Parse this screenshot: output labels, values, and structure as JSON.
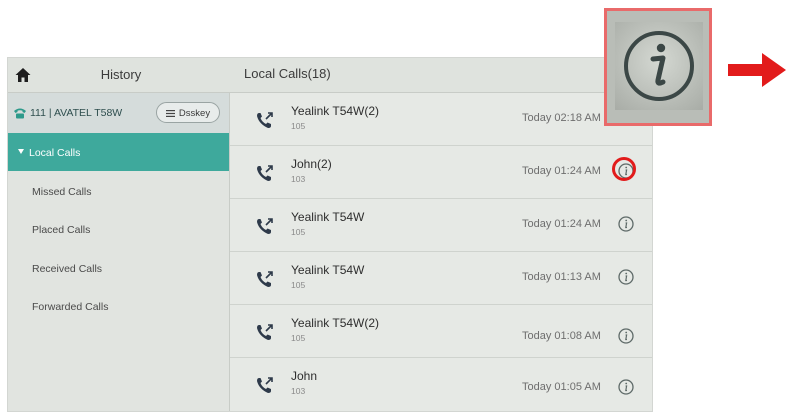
{
  "header": {
    "home_icon": "home-icon",
    "title": "History",
    "content_title": "Local Calls(18)"
  },
  "account": {
    "label": "111 | AVATEL T58W",
    "dsskey_label": "Dsskey"
  },
  "sidebar": {
    "items": [
      {
        "label": "Local Calls",
        "active": true
      },
      {
        "label": "Missed Calls",
        "active": false
      },
      {
        "label": "Placed Calls",
        "active": false
      },
      {
        "label": "Received Calls",
        "active": false
      },
      {
        "label": "Forwarded Calls",
        "active": false
      }
    ]
  },
  "calls": [
    {
      "name": "Yealink T54W(2)",
      "number": "105",
      "time": "Today 02:18 AM"
    },
    {
      "name": "John(2)",
      "number": "103",
      "time": "Today 01:24 AM"
    },
    {
      "name": "Yealink T54W",
      "number": "105",
      "time": "Today 01:24 AM"
    },
    {
      "name": "Yealink T54W",
      "number": "105",
      "time": "Today 01:13 AM"
    },
    {
      "name": "Yealink T54W(2)",
      "number": "105",
      "time": "Today 01:08 AM"
    },
    {
      "name": "John",
      "number": "103",
      "time": "Today 01:05 AM"
    }
  ],
  "colors": {
    "accent": "#3ea99c",
    "highlight": "#e21b1b",
    "callout_border": "#e96a6a"
  }
}
